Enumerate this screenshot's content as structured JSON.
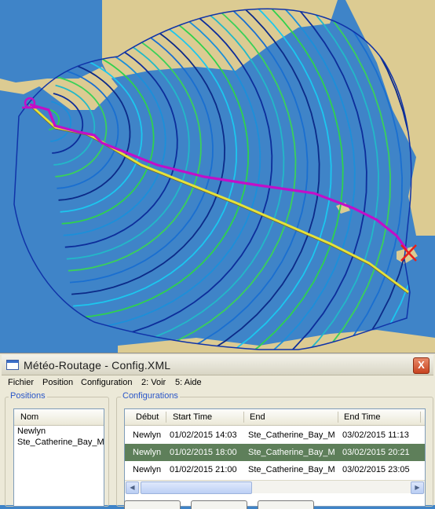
{
  "window": {
    "title": "Météo-Routage - Config.XML",
    "close_label": "X"
  },
  "menu": {
    "items": [
      "Fichier",
      "Position",
      "Configuration",
      "2: Voir",
      "5: Aide"
    ]
  },
  "positions": {
    "group_label": "Positions",
    "column": "Nom",
    "items": [
      "Newlyn",
      "Ste_Catherine_Bay_M"
    ]
  },
  "configurations": {
    "group_label": "Configurations",
    "columns": [
      "Début",
      "Start Time",
      "End",
      "End Time"
    ],
    "rows": [
      [
        "Newlyn",
        "01/02/2015 14:03",
        "Ste_Catherine_Bay_M",
        "03/02/2015 11:13"
      ],
      [
        "Newlyn",
        "01/02/2015 18:00",
        "Ste_Catherine_Bay_M",
        "03/02/2015 20:21"
      ],
      [
        "Newlyn",
        "01/02/2015 21:00",
        "Ste_Catherine_Bay_M",
        "03/02/2015 23:05"
      ]
    ],
    "selected_row": 1
  },
  "map": {
    "sea_color": "#3f84c8",
    "land_color": "#dccb92",
    "route_primary_color": "#c10fc8",
    "route_direct_color": "#e6e23a",
    "start_marker": "start-circle",
    "end_marker": "end-cross"
  }
}
